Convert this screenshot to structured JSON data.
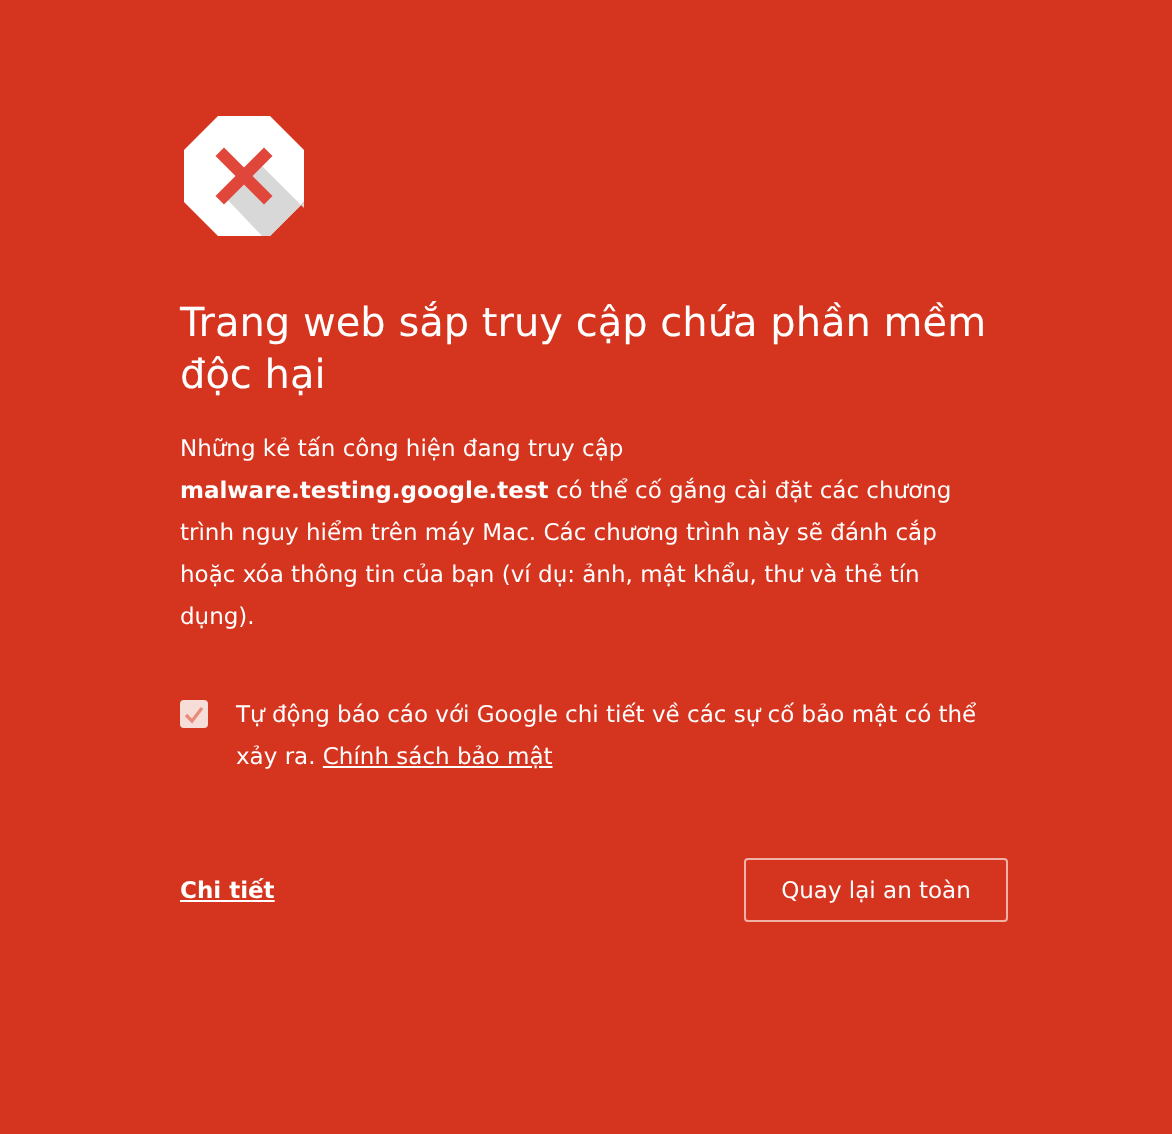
{
  "title": "Trang web sắp truy cập chứa phần mềm độc hại",
  "message": "Những kẻ tấn công hiện đang truy cập **malware.testing.google.test** có thể cố gắng cài đặt các chương trình nguy hiểm trên máy Mac. Các chương trình này sẽ đánh cắp hoặc xóa thông tin của bạn (ví dụ: ảnh, mật khẩu, thư và thẻ tín dụng).",
  "report_option": {
    "label": "Tự động báo cáo với Google chi tiết về các sự cố bảo mật có thể xảy ra.",
    "link": "Chính sách bảo mật",
    "checked": true
  },
  "details_link": "Chi tiết",
  "back_button": "Quay lại an toàn"
}
